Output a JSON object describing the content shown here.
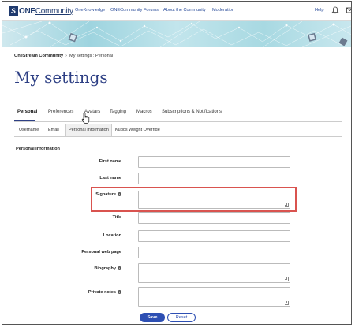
{
  "nav": {
    "logo_text_1": "ONE",
    "logo_text_2": "Community",
    "links": [
      "OneKnowledge",
      "ONECommunity Forums",
      "About the Community",
      "Moderation"
    ],
    "help": "Help"
  },
  "breadcrumb": {
    "root": "OneStream Community",
    "sep": "›",
    "current": "My settings : Personal"
  },
  "page_title": "My settings",
  "tabs": [
    "Personal",
    "Preferences",
    "Avatars",
    "Tagging",
    "Macros",
    "Subscriptions & Notifications"
  ],
  "active_tab": "Personal",
  "subtabs": [
    "Username",
    "Email",
    "Personal Information",
    "Kudos Weight Override"
  ],
  "active_subtab": "Personal Information",
  "section_title": "Personal Information",
  "fields": [
    {
      "label": "First name",
      "value": ""
    },
    {
      "label": "Last name",
      "value": ""
    },
    {
      "label": "Signature",
      "value": "",
      "info": "i"
    },
    {
      "label": "Title",
      "value": ""
    },
    {
      "label": "Location",
      "value": ""
    },
    {
      "label": "Personal web page",
      "value": ""
    },
    {
      "label": "Biography",
      "value": "",
      "info": "i"
    },
    {
      "label": "Private notes",
      "value": "",
      "info": "i"
    }
  ],
  "buttons": {
    "save": "Save",
    "reset": "Reset"
  },
  "colors": {
    "brand": "#2d3f84",
    "accent": "#2d4fb3",
    "highlight": "#d9534f"
  },
  "icons": {
    "bell": "bell-icon",
    "mail": "mail-icon",
    "info": "info-icon",
    "cursor": "hand-cursor-icon"
  }
}
